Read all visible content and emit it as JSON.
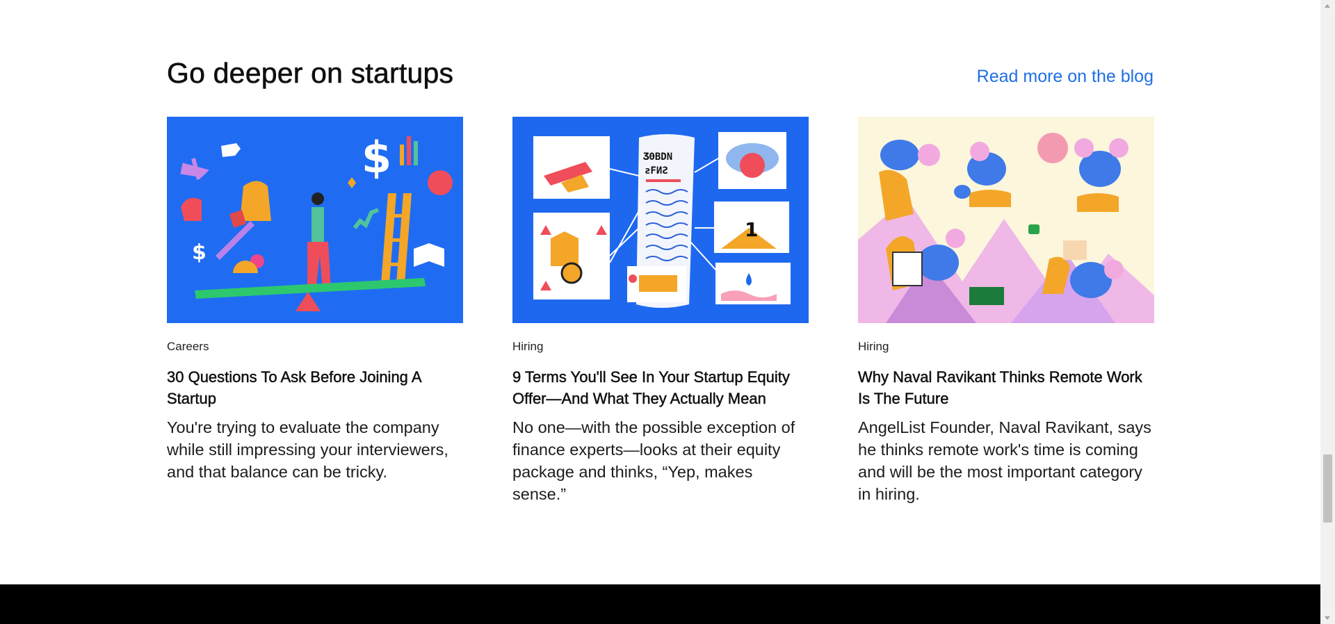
{
  "section": {
    "title": "Go deeper on startups",
    "blog_link_label": "Read more on the blog"
  },
  "cards": [
    {
      "category": "Careers",
      "title": "30 Questions To Ask Before Joining A Startup",
      "excerpt": "You're trying to evaluate the company while still impressing your interviewers, and that balance can be tricky.",
      "image_icon": "career-seesaw-illustration",
      "image_bg": "#1f6cf2"
    },
    {
      "category": "Hiring",
      "title": "9 Terms You'll See In Your Startup Equity Offer—And What They Actually Mean",
      "excerpt": "No one—with the possible exception of finance experts—looks at their equity package and thinks, “Yep, makes sense.”",
      "image_icon": "equity-document-illustration",
      "image_bg": "#1e68f0"
    },
    {
      "category": "Hiring",
      "title": "Why Naval Ravikant Thinks Remote Work Is The Future",
      "excerpt": "AngelList Founder, Naval Ravikant, says he thinks remote work's time is coming and will be the most important category in hiring.",
      "image_icon": "remote-workers-illustration",
      "image_bg": "#fbf6dc"
    }
  ],
  "colors": {
    "link": "#1f6fe6",
    "footer": "#000000"
  }
}
